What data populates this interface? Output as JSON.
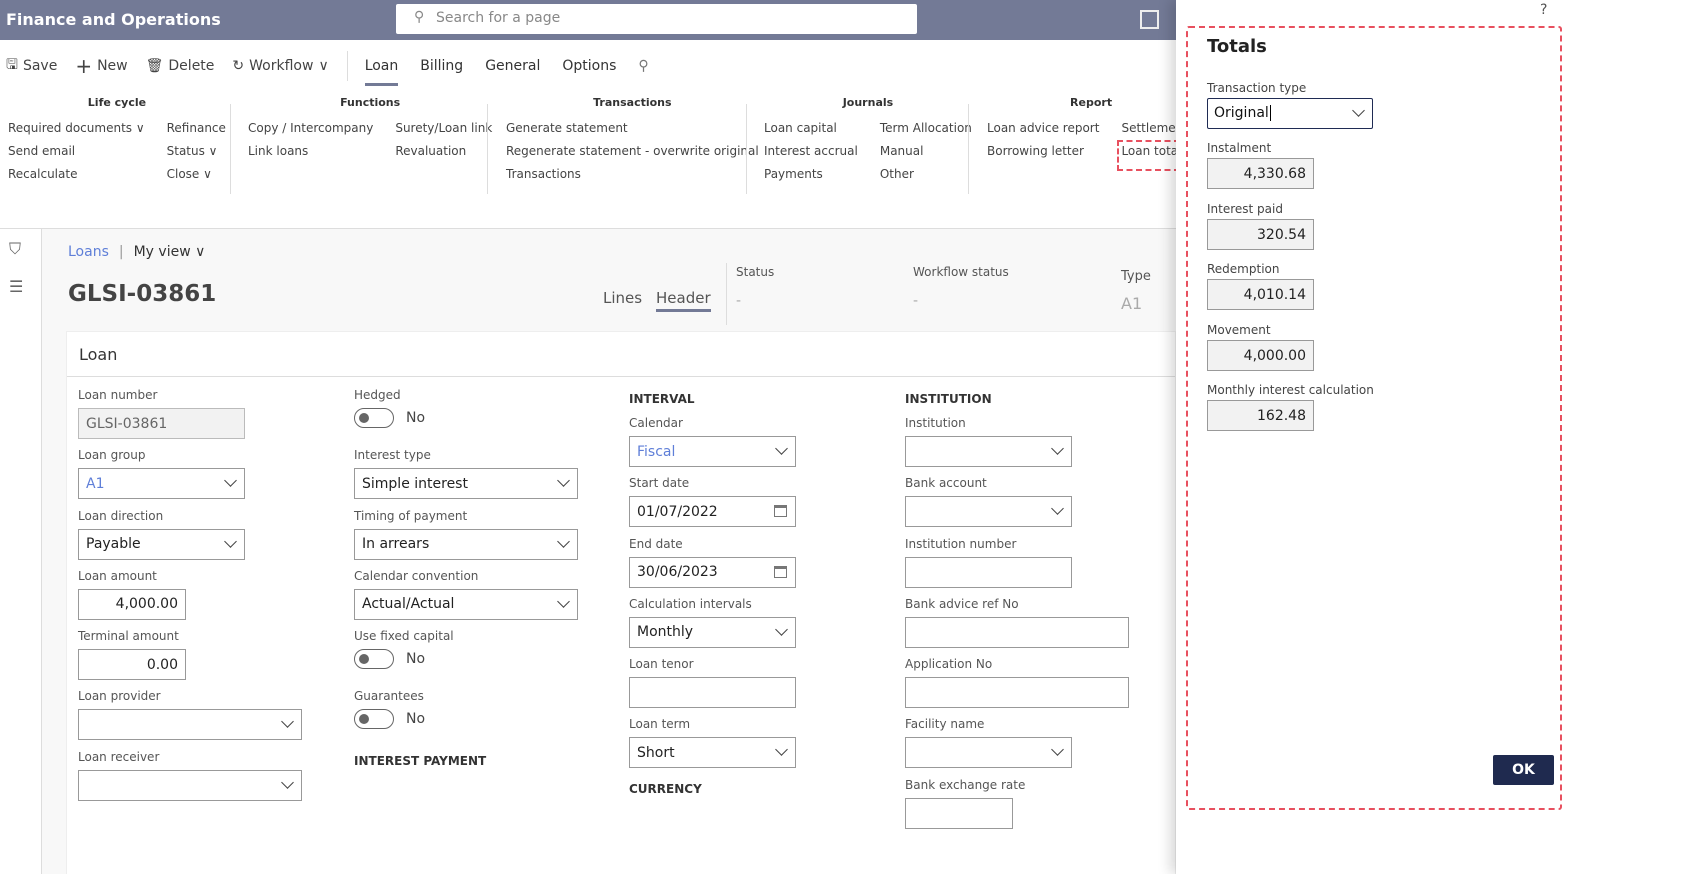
{
  "app": {
    "title": "Finance and Operations",
    "search_placeholder": "Search for a page"
  },
  "actions": {
    "save": "Save",
    "new": "New",
    "delete": "Delete",
    "workflow": "Workflow"
  },
  "tabs": [
    "Loan",
    "Billing",
    "General",
    "Options"
  ],
  "ribbon": [
    {
      "title": "Life cycle",
      "cols": [
        [
          "Required documents ∨",
          "Send email",
          "Recalculate"
        ],
        [
          "Refinance",
          "Status ∨",
          "Close ∨"
        ]
      ]
    },
    {
      "title": "Functions",
      "cols": [
        [
          "Copy / Intercompany",
          "Link loans"
        ],
        [
          "Surety/Loan link",
          "Revaluation"
        ]
      ]
    },
    {
      "title": "Transactions",
      "cols": [
        [
          "Generate statement",
          "Regenerate statement - overwrite original",
          "Transactions"
        ]
      ]
    },
    {
      "title": "Journals",
      "cols": [
        [
          "Loan capital",
          "Interest accrual",
          "Payments"
        ],
        [
          "Term Allocation",
          "Manual",
          "Other"
        ]
      ]
    },
    {
      "title": "Report",
      "cols": [
        [
          "Loan advice report",
          "Borrowing letter"
        ],
        [
          "Settlement l",
          "Loan totals"
        ]
      ]
    }
  ],
  "record": {
    "breadcrumb": "Loans",
    "view": "My view",
    "id": "GLSI-03861",
    "view_tabs": [
      "Lines",
      "Header"
    ],
    "status_label": "Status",
    "status": "-",
    "workflow_label": "Workflow status",
    "workflow": "-",
    "type_label": "Type",
    "type": "A1"
  },
  "card_title": "Loan",
  "form": [
    [
      {
        "t": "ro",
        "l": "Loan number",
        "v": "GLSI-03861",
        "w": 167
      },
      {
        "t": "sel",
        "l": "Loan group",
        "v": "A1",
        "w": 167,
        "link": true
      },
      {
        "t": "sel",
        "l": "Loan direction",
        "v": "Payable",
        "w": 167
      },
      {
        "t": "num",
        "l": "Loan amount",
        "v": "4,000.00",
        "w": 108
      },
      {
        "t": "num",
        "l": "Terminal amount",
        "v": "0.00",
        "w": 108
      },
      {
        "t": "sel",
        "l": "Loan provider",
        "v": "",
        "w": 224
      },
      {
        "t": "sel",
        "l": "Loan receiver",
        "v": "",
        "w": 224
      }
    ],
    [
      {
        "t": "tog",
        "l": "Hedged",
        "v": "No"
      },
      {
        "t": "sel",
        "l": "Interest type",
        "v": "Simple interest",
        "w": 224
      },
      {
        "t": "sel",
        "l": "Timing of payment",
        "v": "In arrears",
        "w": 224
      },
      {
        "t": "sel",
        "l": "Calendar convention",
        "v": "Actual/Actual",
        "w": 224
      },
      {
        "t": "tog",
        "l": "Use fixed capital",
        "v": "No"
      },
      {
        "t": "tog",
        "l": "Guarantees",
        "v": "No"
      },
      {
        "t": "head",
        "l": "INTEREST PAYMENT"
      }
    ],
    [
      {
        "t": "head",
        "l": "INTERVAL"
      },
      {
        "t": "sel",
        "l": "Calendar",
        "v": "Fiscal",
        "w": 167,
        "link": true
      },
      {
        "t": "date",
        "l": "Start date",
        "v": "01/07/2022",
        "w": 167
      },
      {
        "t": "date",
        "l": "End date",
        "v": "30/06/2023",
        "w": 167
      },
      {
        "t": "sel",
        "l": "Calculation intervals",
        "v": "Monthly",
        "w": 167
      },
      {
        "t": "txt",
        "l": "Loan tenor",
        "v": "",
        "w": 167
      },
      {
        "t": "sel",
        "l": "Loan term",
        "v": "Short",
        "w": 167
      },
      {
        "t": "head",
        "l": "CURRENCY"
      }
    ],
    [
      {
        "t": "head",
        "l": "INSTITUTION"
      },
      {
        "t": "sel",
        "l": "Institution",
        "v": "",
        "w": 167
      },
      {
        "t": "sel",
        "l": "Bank account",
        "v": "",
        "w": 167
      },
      {
        "t": "txt",
        "l": "Institution number",
        "v": "",
        "w": 167
      },
      {
        "t": "txt",
        "l": "Bank advice ref No",
        "v": "",
        "w": 224
      },
      {
        "t": "txt",
        "l": "Application No",
        "v": "",
        "w": 224
      },
      {
        "t": "sel",
        "l": "Facility name",
        "v": "",
        "w": 167
      },
      {
        "t": "txt",
        "l": "Bank exchange rate",
        "v": "",
        "w": 108
      }
    ]
  ],
  "totals": {
    "help": "?",
    "title": "Totals",
    "transaction_type_label": "Transaction type",
    "transaction_type": "Original",
    "fields": [
      {
        "label": "Instalment",
        "value": "4,330.68"
      },
      {
        "label": "Interest paid",
        "value": "320.54"
      },
      {
        "label": "Redemption",
        "value": "4,010.14"
      },
      {
        "label": "Movement",
        "value": "4,000.00"
      },
      {
        "label": "Monthly interest calculation",
        "value": "162.48"
      }
    ],
    "ok": "OK"
  },
  "colors": {
    "topbar": "#737a96",
    "accent": "#1f2a4f",
    "highlight": "#e8505f",
    "link": "#5f7fd8"
  }
}
